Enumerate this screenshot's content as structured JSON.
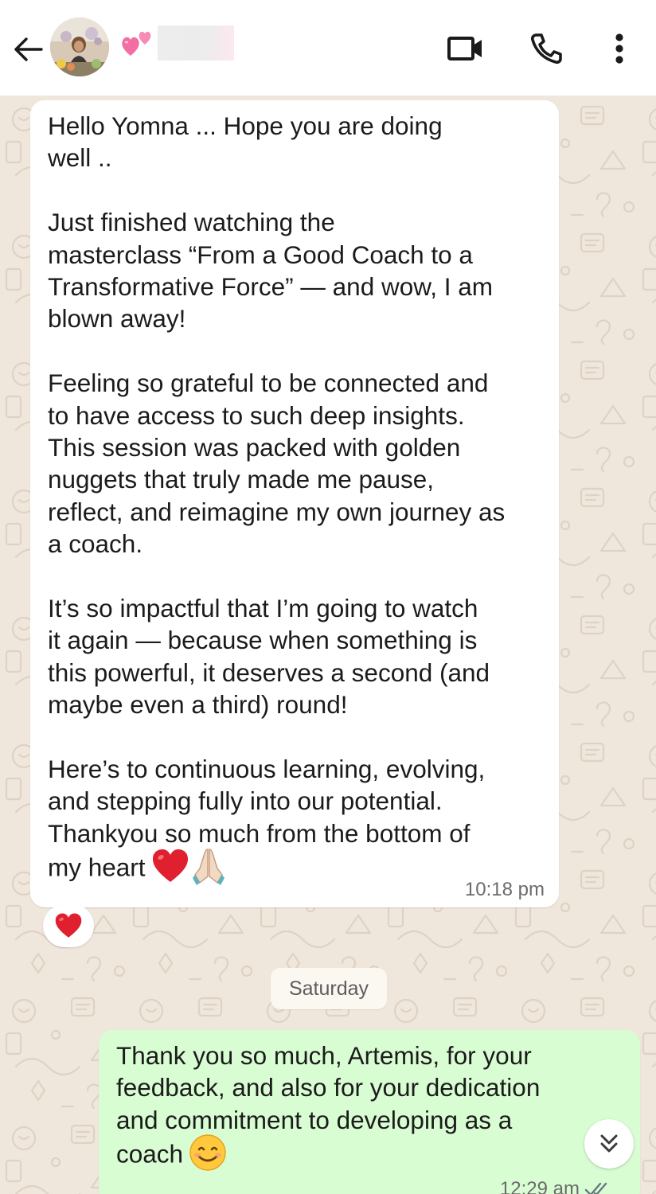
{
  "header": {
    "back_icon": "arrow-left-icon",
    "contact_name": "████",
    "name_prefix_icon": "two-hearts-emoji",
    "actions": [
      "video-call-icon",
      "voice-call-icon",
      "more-vertical-icon"
    ]
  },
  "messages": [
    {
      "direction": "incoming",
      "paragraphs": [
        [
          "Hello Yomna ... Hope you are doing",
          "well .."
        ],
        [
          "Just finished watching the",
          "masterclass “From a Good Coach to a",
          "Transformative Force” — and wow, I am",
          "blown away!"
        ],
        [
          "Feeling so grateful to be connected and",
          "to have access to such deep insights.",
          "This session was packed with golden",
          "nuggets that truly made me pause,",
          "reflect, and reimagine my own journey as",
          "a coach."
        ],
        [
          "It’s so impactful that I’m going to watch",
          "it again — because when something is",
          "this powerful, it deserves a second (and",
          "maybe even a third) round!"
        ],
        [
          "Here’s to continuous learning, evolving,",
          "and stepping fully into our potential.",
          "Thankyou so much from the bottom of",
          "my heart"
        ]
      ],
      "trailing_emojis": [
        "red-heart-emoji",
        "folded-hands-emoji"
      ],
      "time": "10:18 pm",
      "reaction": "red-heart-emoji"
    },
    {
      "direction": "outgoing",
      "lines": [
        "Thank you so much, Artemis, for your",
        "feedback, and also for your dedication",
        "and commitment to developing as a",
        "coach"
      ],
      "trailing_emoji": "smiling-face-emoji",
      "time": "12:29 am",
      "status": "read",
      "status_icon": "double-check-icon"
    }
  ],
  "date_separator": "Saturday",
  "scroll_button_icon": "double-chevron-down-icon",
  "colors": {
    "header_bg": "#ffffff",
    "chat_bg": "#efe7dc",
    "incoming_bubble": "#ffffff",
    "outgoing_bubble": "#d9fdd3",
    "timestamp": "#6b6b6b",
    "read_ticks": "#667781"
  }
}
